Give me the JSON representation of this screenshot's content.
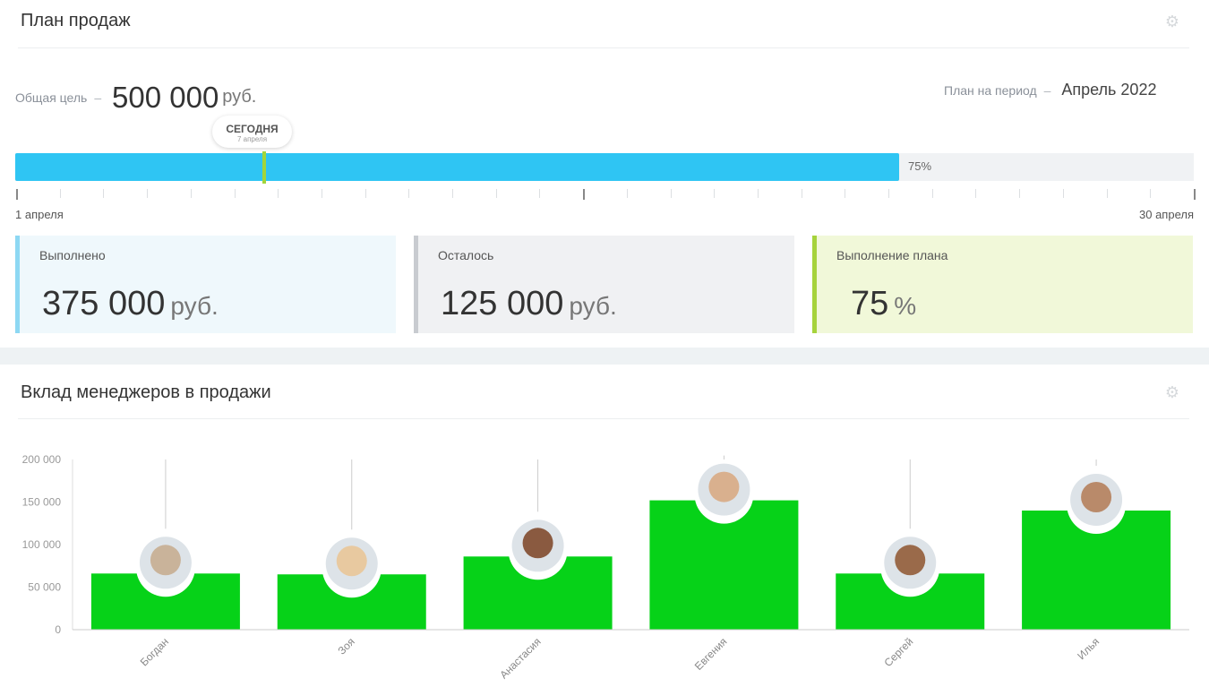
{
  "plan": {
    "title": "План продаж",
    "goal_label": "Общая цель",
    "goal_value": "500 000",
    "currency": "руб.",
    "period_label": "План на период",
    "period_value": "Апрель 2022",
    "progress_percent": 75,
    "progress_label": "75%",
    "today_title": "СЕГОДНЯ",
    "today_date": "7 апреля",
    "today_day": 7,
    "days_in_month": 30,
    "start_label": "1 апреля",
    "end_label": "30 апреля",
    "cards": [
      {
        "title": "Выполнено",
        "value": "375 000",
        "unit": "руб.",
        "bg": "#eff8fc",
        "accent": "#8dd8f3"
      },
      {
        "title": "Осталось",
        "value": "125 000",
        "unit": "руб.",
        "bg": "#f0f1f3",
        "accent": "#c8cbd0"
      },
      {
        "title": "Выполнение плана",
        "value": "75",
        "unit": "%",
        "bg": "#f1f8d9",
        "accent": "#a6d33c"
      }
    ]
  },
  "managers": {
    "title": "Вклад менеджеров в продажи"
  },
  "chart_data": {
    "type": "bar",
    "title": "Вклад менеджеров в продажи",
    "categories": [
      "Богдан",
      "Зоя",
      "Анастасия",
      "Евгения",
      "Сергей",
      "Илья"
    ],
    "values": [
      66000,
      65000,
      86000,
      152000,
      66000,
      140000
    ],
    "ylim": [
      0,
      200000
    ],
    "yticks": [
      "0",
      "50 000",
      "100 000",
      "150 000",
      "200 000"
    ],
    "color": "#06d218"
  }
}
